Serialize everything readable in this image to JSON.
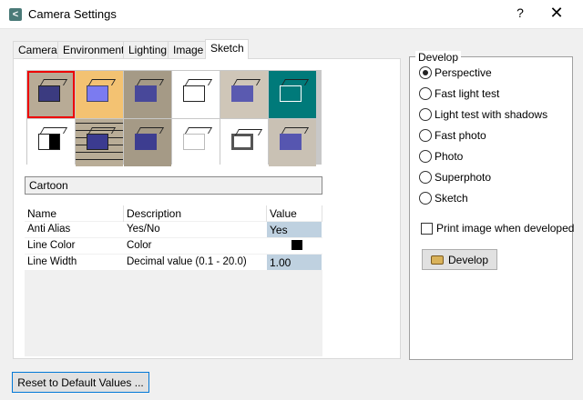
{
  "window": {
    "title": "Camera Settings",
    "help": "?",
    "close": "✕"
  },
  "tabs": [
    {
      "label": "Camera"
    },
    {
      "label": "Environment"
    },
    {
      "label": "Lighting"
    },
    {
      "label": "Image"
    },
    {
      "label": "Sketch",
      "selected": true
    }
  ],
  "sketch": {
    "selected_style": "Cartoon",
    "table": {
      "headers": [
        "Name",
        "Description",
        "Value"
      ],
      "rows": [
        {
          "name": "Anti Alias",
          "description": "Yes/No",
          "value": "Yes"
        },
        {
          "name": "Line Color",
          "description": "Color",
          "value_color": "#000000"
        },
        {
          "name": "Line Width",
          "description": "Decimal value (0.1 - 20.0)",
          "value": "1.00"
        }
      ]
    }
  },
  "develop": {
    "group_label": "Develop",
    "options": [
      "Perspective",
      "Fast light test",
      "Light test with shadows",
      "Fast photo",
      "Photo",
      "Superphoto",
      "Sketch"
    ],
    "selected": "Perspective",
    "print_label": "Print image when developed",
    "print_checked": false,
    "button_label": "Develop"
  },
  "reset_label": "Reset to Default Values ..."
}
